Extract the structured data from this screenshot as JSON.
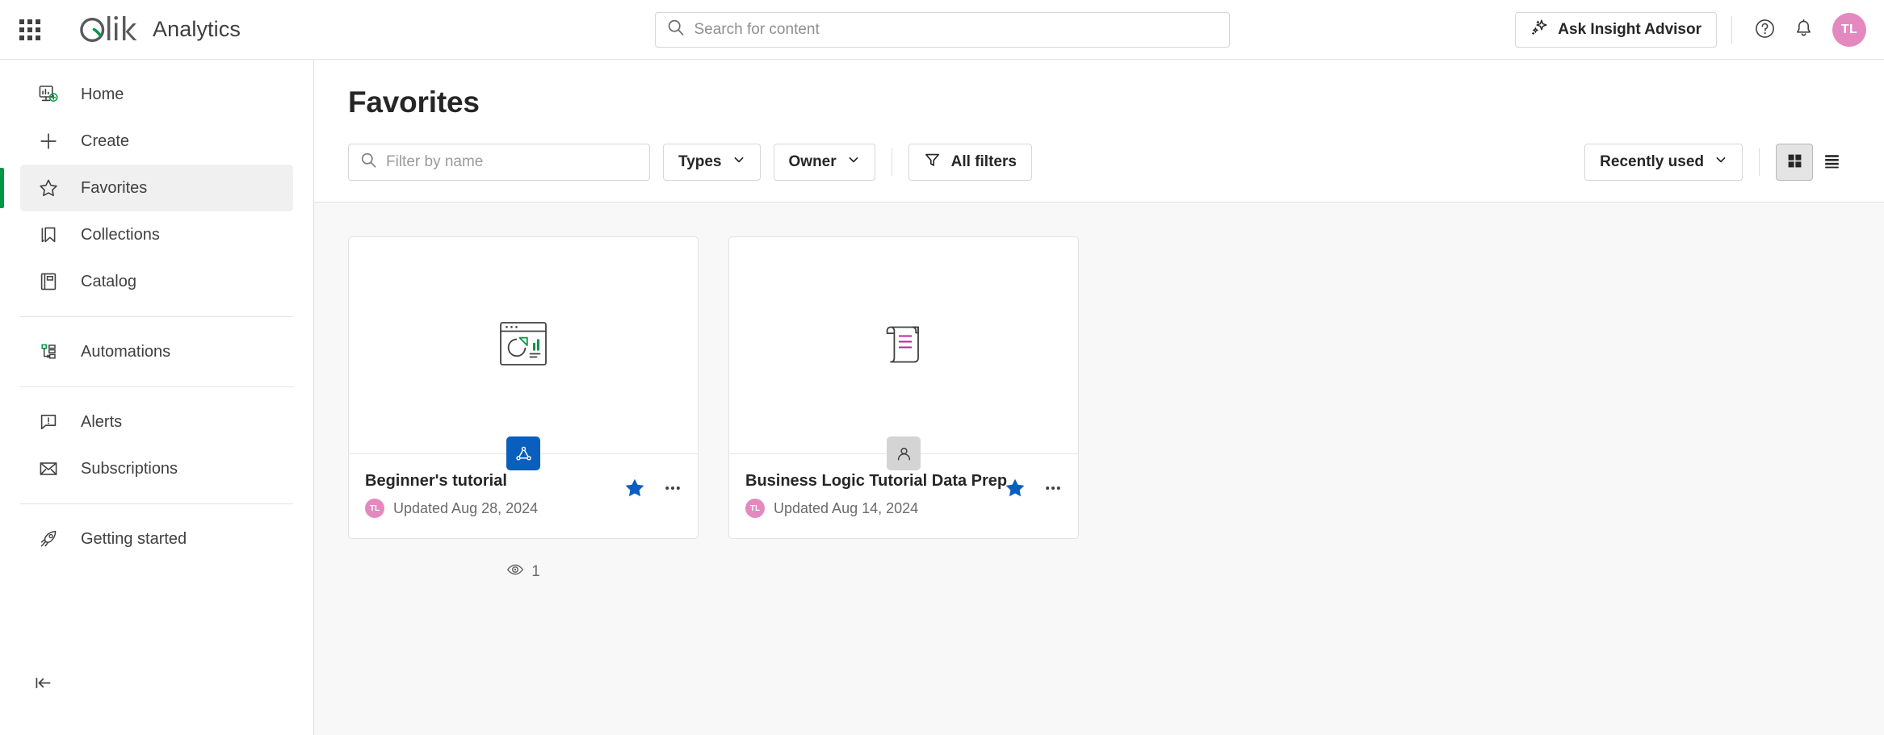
{
  "header": {
    "launcher_icon": "app-launcher-grid-icon",
    "brand": "Analytics",
    "search": {
      "placeholder": "Search for content",
      "value": ""
    },
    "insight_advisor_label": "Ask Insight Advisor",
    "help_icon": "help-circle-icon",
    "notifications_icon": "bell-icon",
    "avatar_initials": "TL"
  },
  "sidebar": {
    "items": [
      {
        "label": "Home",
        "icon": "home-dashboard-icon",
        "active": false
      },
      {
        "label": "Create",
        "icon": "plus-icon",
        "active": false
      },
      {
        "label": "Favorites",
        "icon": "star-outline-icon",
        "active": true
      },
      {
        "label": "Collections",
        "icon": "bookmark-icon",
        "active": false
      },
      {
        "label": "Catalog",
        "icon": "book-icon",
        "active": false
      },
      {
        "label": "Automations",
        "icon": "automation-flow-icon",
        "active": false
      },
      {
        "label": "Alerts",
        "icon": "alert-bubble-icon",
        "active": false
      },
      {
        "label": "Subscriptions",
        "icon": "envelope-icon",
        "active": false
      },
      {
        "label": "Getting started",
        "icon": "rocket-icon",
        "active": false
      }
    ],
    "collapse_icon": "collapse-sidebar-icon"
  },
  "main": {
    "title": "Favorites",
    "filter": {
      "placeholder": "Filter by name",
      "value": ""
    },
    "types_label": "Types",
    "owner_label": "Owner",
    "all_filters_label": "All filters",
    "sort_label": "Recently used",
    "grid_view_icon": "grid-view-icon",
    "list_view_icon": "list-view-icon",
    "active_view": "grid"
  },
  "cards": [
    {
      "title": "Beginner's tutorial",
      "date": "Updated Aug 28, 2024",
      "owner_initials": "TL",
      "thumb_icon": "app-chart-thumbnail-icon",
      "badge_icon": "published-app-icon",
      "badge_style": "blue",
      "favorited": true,
      "views": "1"
    },
    {
      "title": "Business Logic Tutorial Data Prep",
      "date": "Updated Aug 14, 2024",
      "owner_initials": "TL",
      "thumb_icon": "script-scroll-thumbnail-icon",
      "badge_icon": "private-owner-icon",
      "badge_style": "gray",
      "favorited": true,
      "views": ""
    }
  ],
  "colors": {
    "brand_green": "#009845",
    "favorite_blue": "#0a5ebd",
    "avatar_pink": "#e489bf",
    "magenta": "#b5249b"
  }
}
